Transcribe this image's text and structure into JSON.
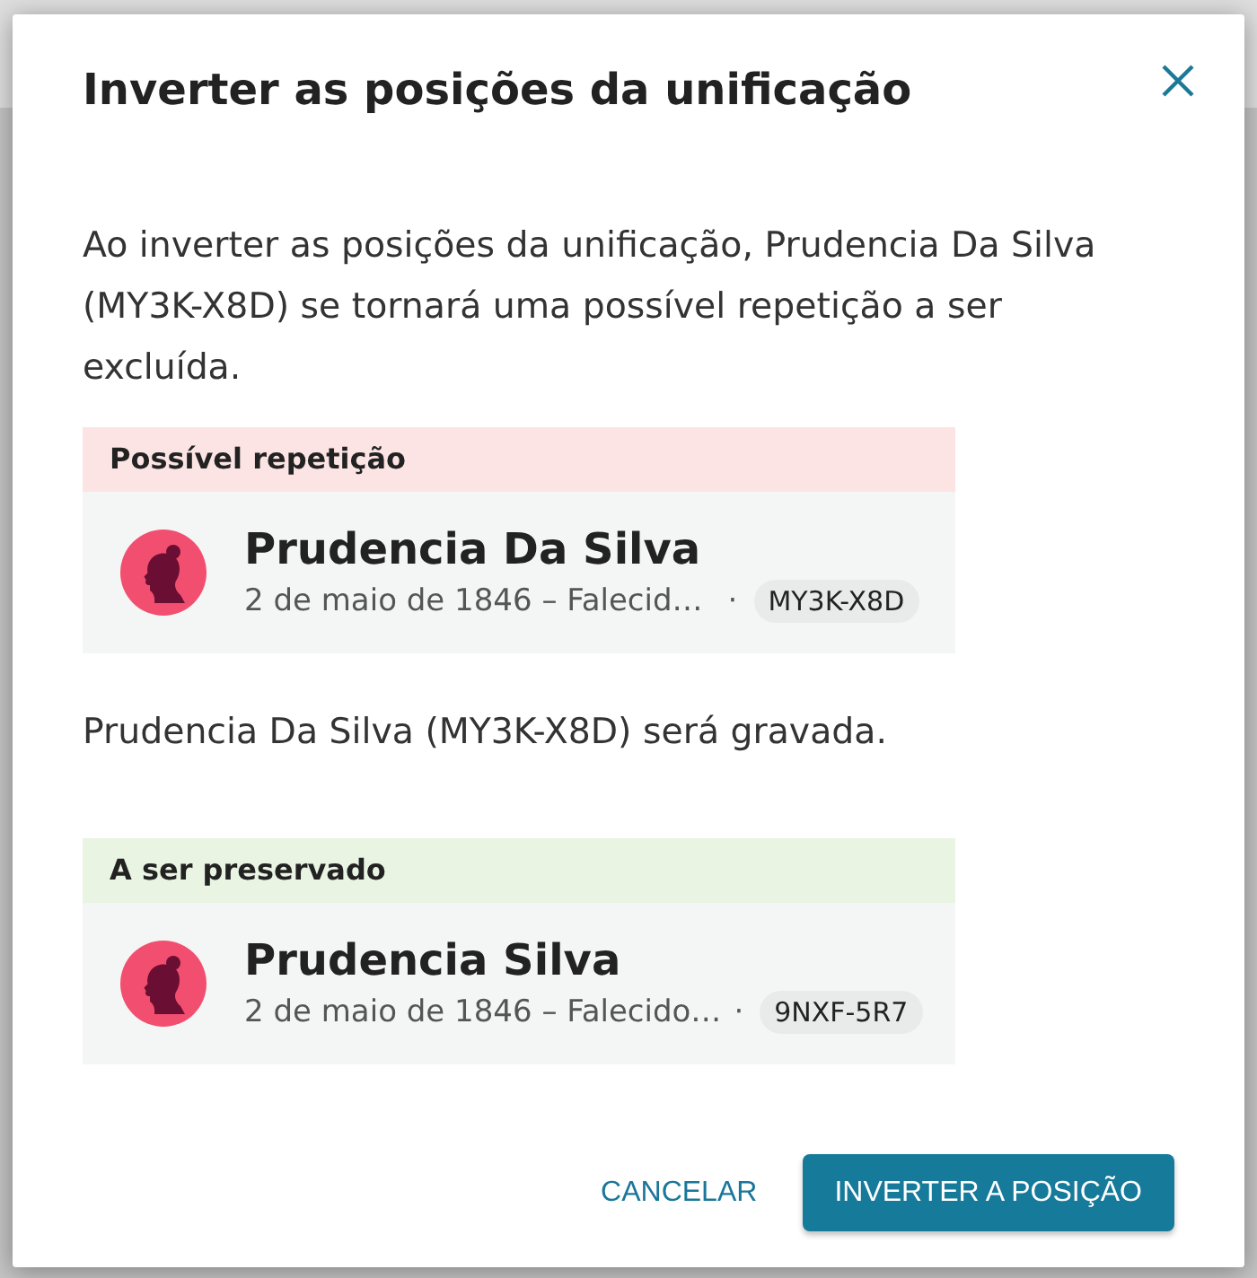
{
  "dialog": {
    "title": "Inverter as posições da unificação"
  },
  "sections": [
    {
      "text": "Ao inverter as posições da unificação, Prudencia Da Silva (MY3K-X8D) se tornará uma possível repetição a ser excluída.",
      "card": {
        "label": "Possível repetição",
        "color": "#fde4e4",
        "name": "Prudencia Da Silva",
        "details": "2 de maio de 1846 – Falecid…",
        "separator": "·",
        "id": "MY3K-X8D"
      }
    },
    {
      "text": "Prudencia Da Silva (MY3K-X8D) será gravada.",
      "card": {
        "label": "A ser preservado",
        "color": "#e9f4e3",
        "name": "Prudencia Silva",
        "details": "2 de maio de 1846 – Falecido…",
        "separator": "·",
        "id": "9NXF-5R7"
      }
    }
  ],
  "buttons": [
    {
      "label": "CANCELAR",
      "kind": "text"
    },
    {
      "label": "INVERTER A POSIÇÃO",
      "kind": "primary"
    }
  ]
}
